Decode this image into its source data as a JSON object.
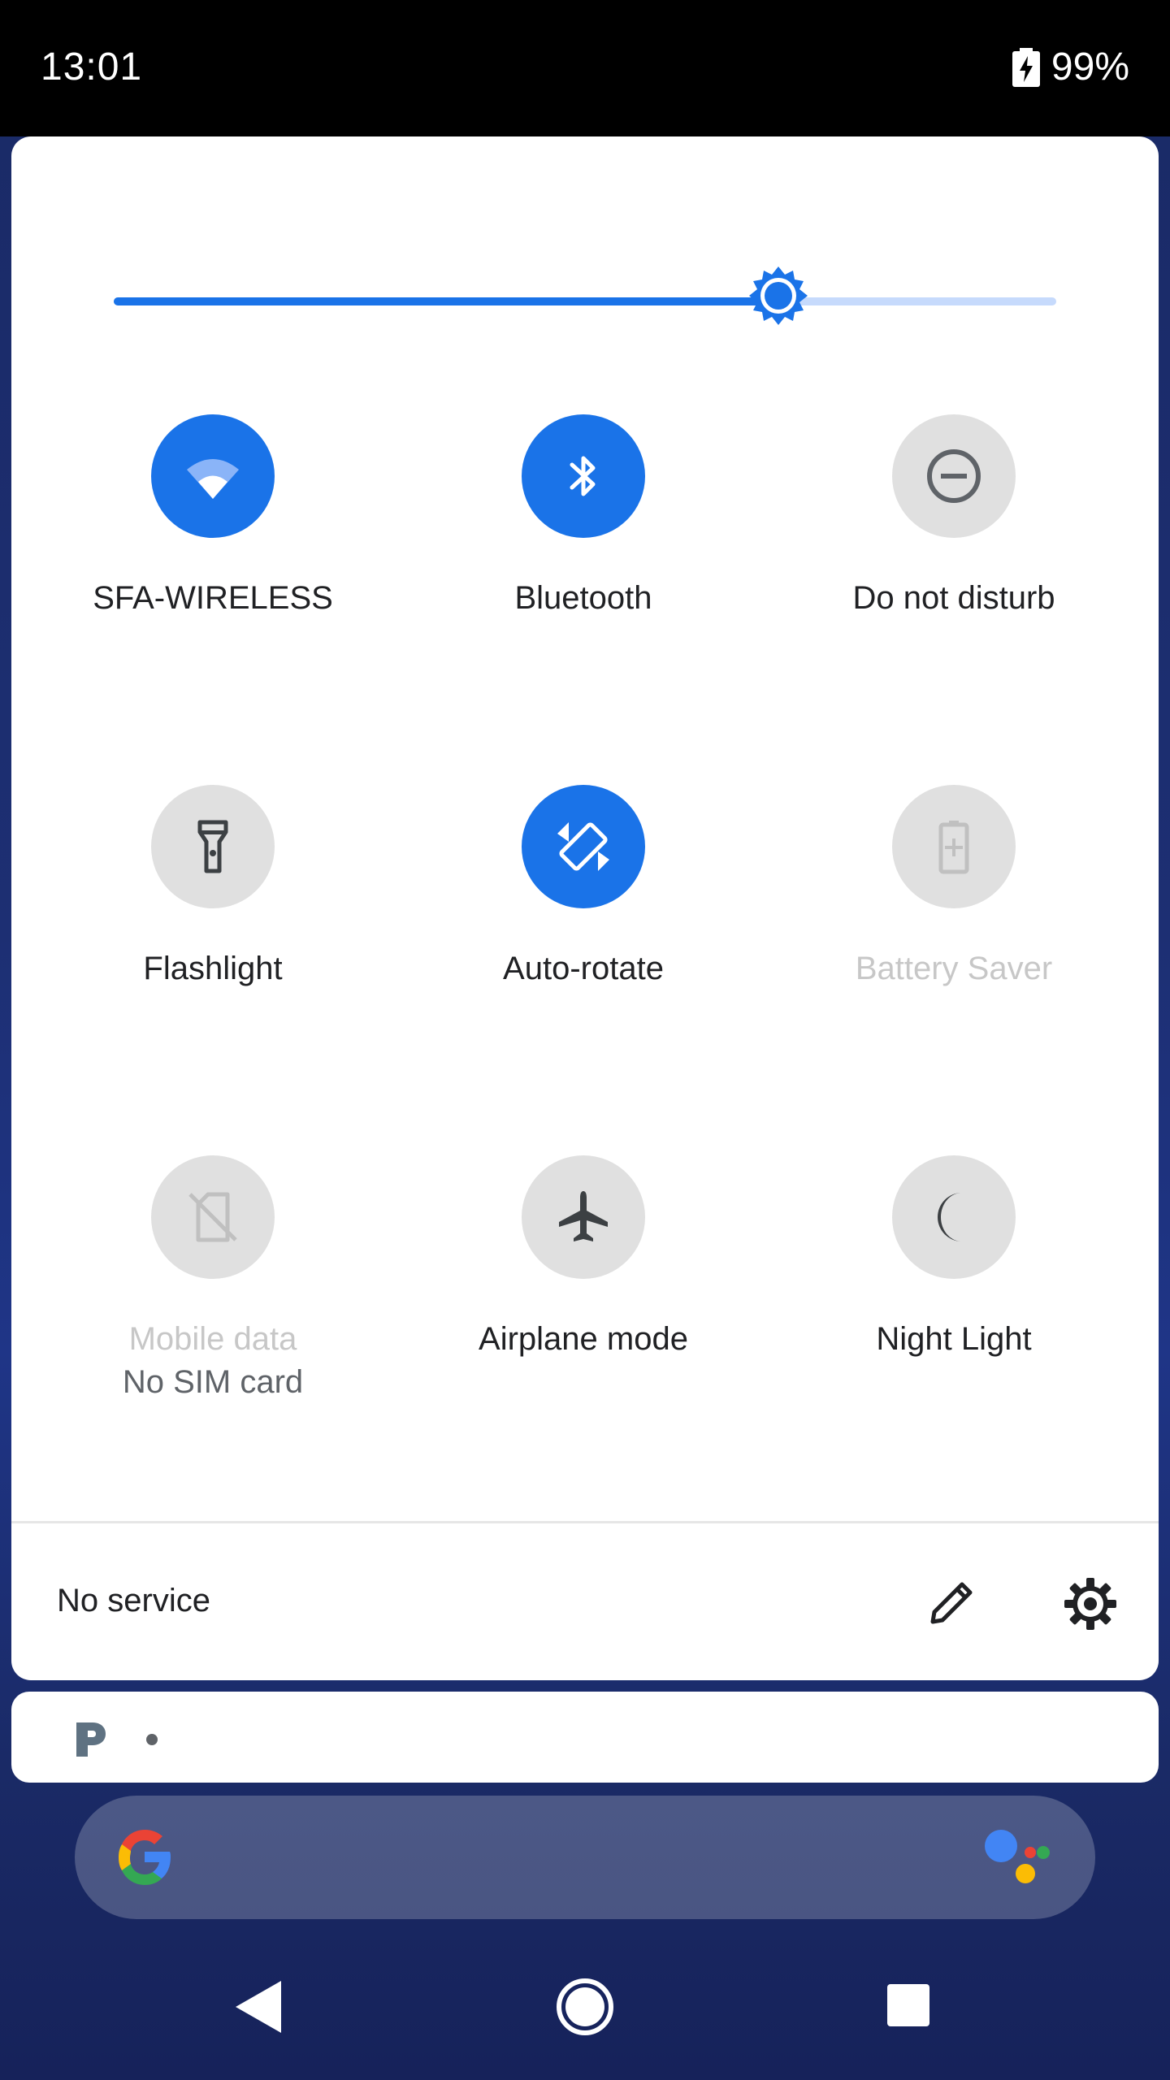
{
  "status_bar": {
    "time": "13:01",
    "battery": "99%"
  },
  "brightness": {
    "level": 0.705,
    "accent_color": "#1a73e8",
    "track_color": "#c6dafc"
  },
  "tiles": [
    {
      "label": "SFA-WIRELESS",
      "icon": "wifi-icon",
      "state": "on"
    },
    {
      "label": "Bluetooth",
      "icon": "bluetooth-icon",
      "state": "on"
    },
    {
      "label": "Do not disturb",
      "icon": "do-not-disturb-icon",
      "state": "off"
    },
    {
      "label": "Flashlight",
      "icon": "flashlight-icon",
      "state": "off"
    },
    {
      "label": "Auto-rotate",
      "icon": "auto-rotate-icon",
      "state": "on"
    },
    {
      "label": "Battery Saver",
      "icon": "battery-saver-icon",
      "state": "unavailable"
    },
    {
      "label": "Mobile data",
      "sublabel": "No SIM card",
      "icon": "mobile-data-off-icon",
      "state": "unavailable"
    },
    {
      "label": "Airplane mode",
      "icon": "airplane-icon",
      "state": "off"
    },
    {
      "label": "Night Light",
      "icon": "night-light-icon",
      "state": "off"
    }
  ],
  "footer": {
    "service_text": "No service",
    "edit_icon": "pencil-icon",
    "settings_icon": "gear-icon"
  },
  "notification": {
    "app_icon": "pandora-icon"
  },
  "search_bar": {
    "logo": "google-g-icon",
    "assistant": "google-assistant-icon"
  },
  "nav_bar": {
    "back": "back-icon",
    "home": "home-icon",
    "recents": "recents-icon"
  }
}
